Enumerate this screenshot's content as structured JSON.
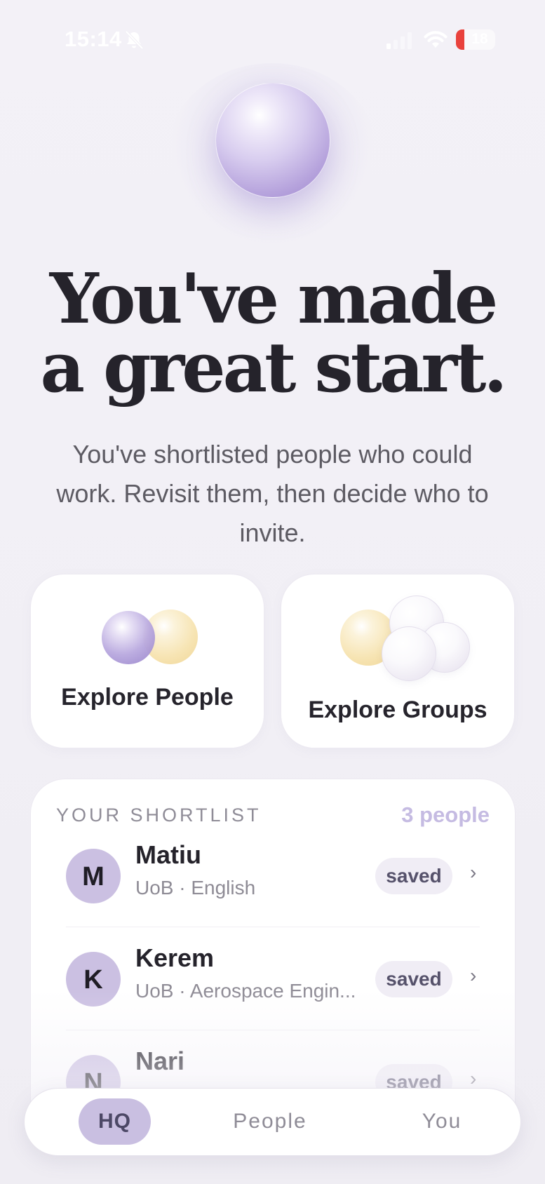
{
  "status_bar": {
    "time": "15:14",
    "battery": "18",
    "icons": [
      "bell-slash-icon",
      "signal-icon",
      "wifi-icon",
      "battery-icon"
    ]
  },
  "hero": {
    "headline": "You've made a great start.",
    "subtext": "You've shortlisted people who could work. Revisit them, then decide who to invite."
  },
  "explore": {
    "people_label": "Explore People",
    "groups_label": "Explore Groups"
  },
  "shortlist": {
    "title": "YOUR SHORTLIST",
    "count": "3 people",
    "people": [
      {
        "initial": "M",
        "name": "Matiu",
        "subtitle": "UoB · English",
        "badge": "saved",
        "chevron": "›"
      },
      {
        "initial": "K",
        "name": "Kerem",
        "subtitle": "UoB · Aerospace Engin...",
        "badge": "saved",
        "chevron": "›"
      },
      {
        "initial": "N",
        "name": "Nari",
        "subtitle": "",
        "badge": "saved",
        "chevron": "›"
      }
    ]
  },
  "nav": {
    "hq": "HQ",
    "people": "People",
    "you": "You",
    "active": "HQ"
  },
  "colors": {
    "accent": "#c9bfe1",
    "avatar": "#cbc0e2",
    "battery_low": "#e9423c",
    "background": "#f2f0f6"
  }
}
